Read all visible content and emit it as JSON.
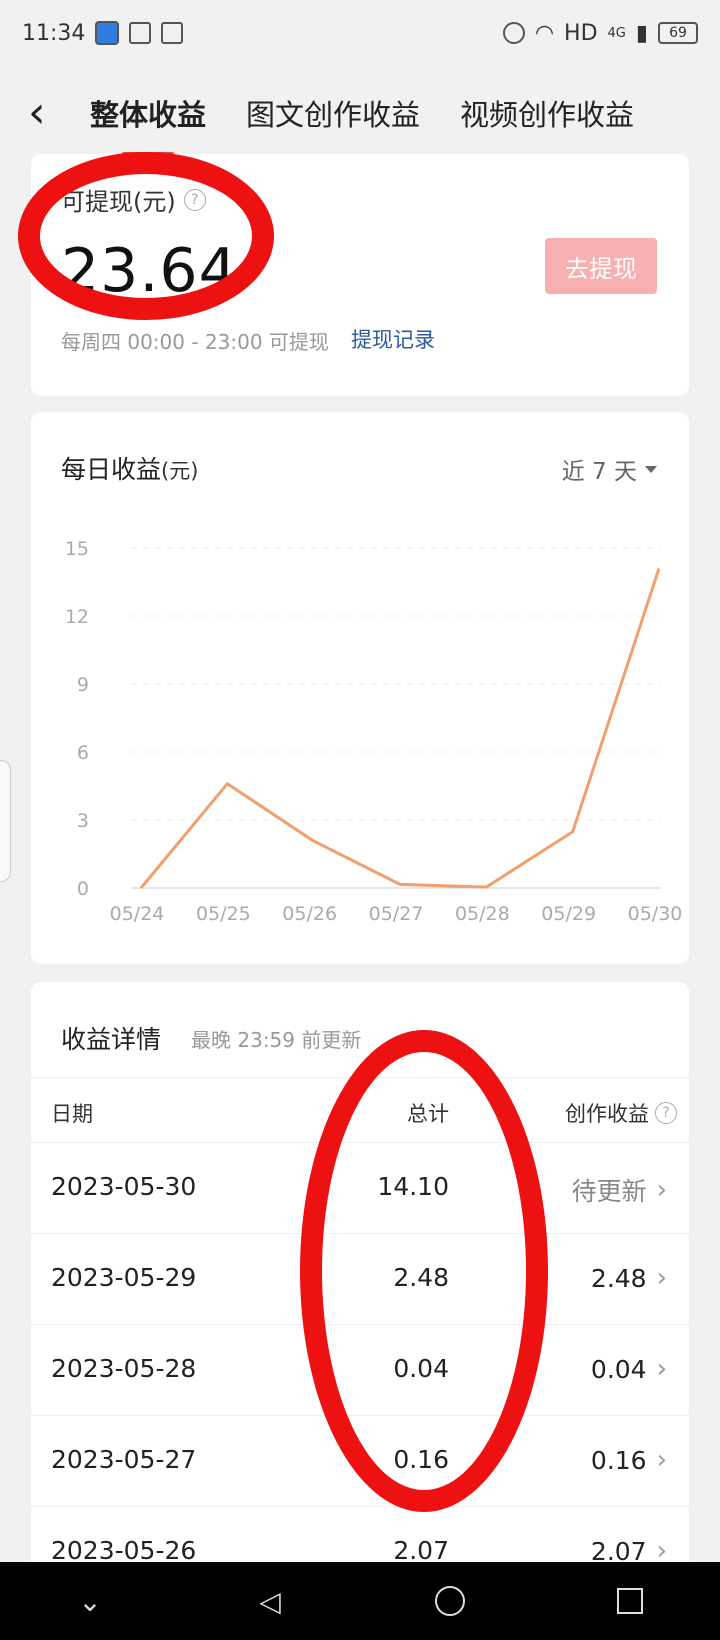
{
  "status_bar": {
    "time": "11:34",
    "network": "HD",
    "battery": "69",
    "signal": "4G"
  },
  "tabs": [
    {
      "label": "整体收益",
      "active": true
    },
    {
      "label": "图文创作收益",
      "active": false
    },
    {
      "label": "视频创作收益",
      "active": false
    }
  ],
  "balance": {
    "label": "可提现(元)",
    "amount": "23.64",
    "button": "去提现",
    "note": "每周四 00:00 - 23:00 可提现",
    "record_link": "提现记录"
  },
  "chart_section": {
    "title": "每日收益",
    "unit": "(元)",
    "range": "近 7 天"
  },
  "chart_data": {
    "type": "line",
    "categories": [
      "05/24",
      "05/25",
      "05/26",
      "05/27",
      "05/28",
      "05/29",
      "05/30"
    ],
    "values": [
      0,
      4.6,
      2.07,
      0.16,
      0.04,
      2.48,
      14.1
    ],
    "yticks": [
      0,
      3,
      6,
      9,
      12,
      15
    ],
    "ylim": [
      0,
      15
    ],
    "line_color": "#f0a06a",
    "grid": true
  },
  "detail": {
    "title": "收益详情",
    "subtitle": "最晚 23:59 前更新",
    "headers": {
      "date": "日期",
      "total": "总计",
      "creation": "创作收益"
    },
    "rows": [
      {
        "date": "2023-05-30",
        "total": "14.10",
        "creation": "待更新"
      },
      {
        "date": "2023-05-29",
        "total": "2.48",
        "creation": "2.48"
      },
      {
        "date": "2023-05-28",
        "total": "0.04",
        "creation": "0.04"
      },
      {
        "date": "2023-05-27",
        "total": "0.16",
        "creation": "0.16"
      },
      {
        "date": "2023-05-26",
        "total": "2.07",
        "creation": "2.07"
      }
    ]
  },
  "colors": {
    "accent": "#e5484d",
    "annotation": "#ee1111",
    "link": "#2c5aa0"
  }
}
